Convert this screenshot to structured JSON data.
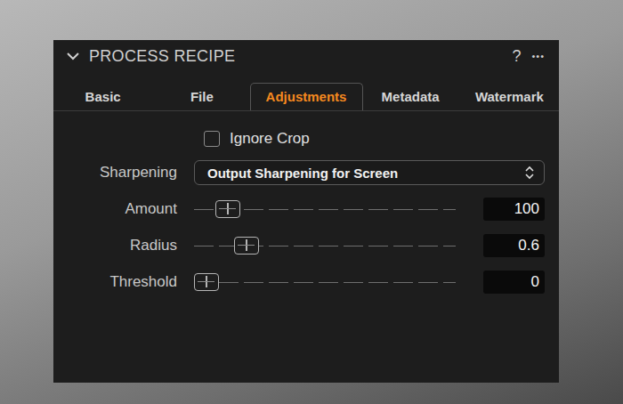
{
  "panel": {
    "title": "PROCESS RECIPE",
    "help": "?",
    "menu": "•••"
  },
  "tabs": [
    {
      "label": "Basic",
      "selected": false
    },
    {
      "label": "File",
      "selected": false
    },
    {
      "label": "Adjustments",
      "selected": true
    },
    {
      "label": "Metadata",
      "selected": false
    },
    {
      "label": "Watermark",
      "selected": false
    }
  ],
  "ignore_crop": {
    "label": "Ignore Crop",
    "checked": false
  },
  "sharpening": {
    "label": "Sharpening",
    "value": "Output Sharpening for Screen"
  },
  "sliders": [
    {
      "label": "Amount",
      "level": 0.09,
      "reading": "100"
    },
    {
      "label": "Radius",
      "level": 0.17,
      "reading": "0.6"
    },
    {
      "label": "Threshold",
      "level": 0,
      "reading": "0"
    }
  ]
}
